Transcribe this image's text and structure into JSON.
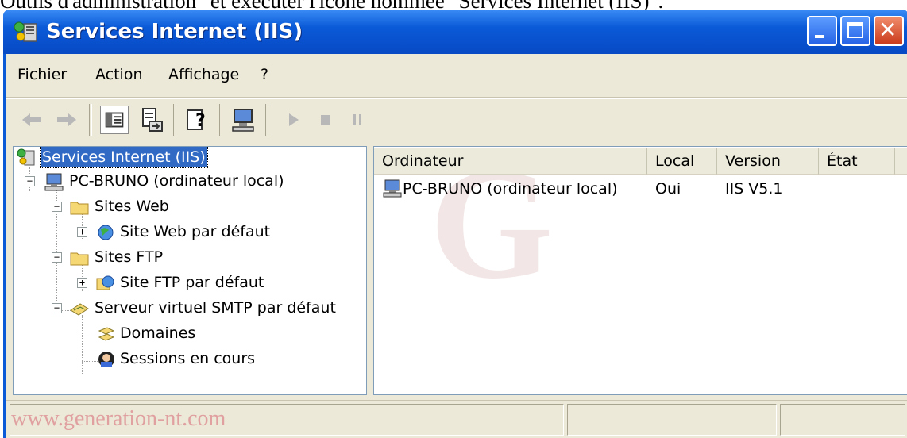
{
  "page_caption": "Outils d'administration\" et exécuter l'icône nommée \"Services Internet (IIS)\".",
  "window": {
    "title": "Services Internet (IIS)",
    "titlebar_color": "#0a5ad8"
  },
  "menu": [
    "Fichier",
    "Action",
    "Affichage",
    "?"
  ],
  "toolbar_icons": [
    "back-arrow-icon",
    "forward-arrow-icon",
    "show-hide-tree-icon",
    "export-list-icon",
    "help-icon",
    "computer-icon",
    "play-icon",
    "stop-icon",
    "pause-icon"
  ],
  "tree": {
    "root": "Services Internet (IIS)",
    "computer": "PC-BRUNO (ordinateur local)",
    "sites_web": "Sites Web",
    "site_web_defaut": "Site Web par défaut",
    "sites_ftp": "Sites FTP",
    "site_ftp_defaut": "Site FTP par défaut",
    "smtp": "Serveur virtuel SMTP par défaut",
    "domaines": "Domaines",
    "sessions": "Sessions en cours"
  },
  "list": {
    "columns": [
      "Ordinateur",
      "Local",
      "Version",
      "État"
    ],
    "rows": [
      {
        "ordinateur": "PC-BRUNO (ordinateur local)",
        "local": "Oui",
        "version": "IIS V5.1",
        "etat": ""
      }
    ]
  },
  "watermark": {
    "letter": "G",
    "url": "www.generation-nt.com"
  }
}
